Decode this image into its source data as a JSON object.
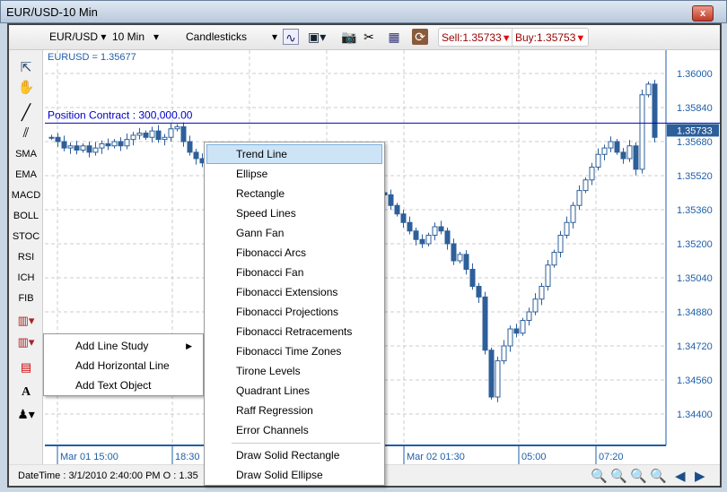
{
  "window": {
    "title": "EUR/USD-10 Min",
    "close": "x"
  },
  "toolbar": {
    "symbol": "EUR/USD",
    "interval": "10 Min",
    "chart_type": "Candlesticks",
    "sell": "Sell:1.35733",
    "buy": "Buy:1.35753",
    "icons": [
      "indicator-chart-icon",
      "save-icon",
      "camera-icon",
      "tools-icon",
      "calculator-icon",
      "refresh-icon"
    ]
  },
  "left_toolbar": {
    "items": [
      "SMA",
      "EMA",
      "MACD",
      "BOLL",
      "STOC",
      "RSI",
      "ICH",
      "FIB"
    ]
  },
  "chart_data": {
    "type": "candlestick",
    "symbol_label": "EURUSD = 1.35677",
    "position_label": "Position  Contract : 300,000.00",
    "position_price": 1.3575,
    "current_price_label": "1.35733",
    "current_price": 1.35733,
    "ylim": [
      1.344,
      1.36
    ],
    "yticks": [
      "1.36000",
      "1.35840",
      "1.35680",
      "1.35520",
      "1.35360",
      "1.35200",
      "1.35040",
      "1.34880",
      "1.34720",
      "1.34560",
      "1.34400"
    ],
    "xticks": [
      "Mar 01 15:00",
      "18:30",
      "Mar 02 01:30",
      "05:00",
      "07:20"
    ],
    "closes": [
      1.357,
      1.3568,
      1.3565,
      1.3566,
      1.3564,
      1.3566,
      1.3563,
      1.3565,
      1.3567,
      1.3566,
      1.3568,
      1.3566,
      1.3569,
      1.3571,
      1.3572,
      1.357,
      1.3573,
      1.3569,
      1.357,
      1.3574,
      1.3575,
      1.3568,
      1.3563,
      1.356,
      1.3558,
      1.3557,
      1.3555,
      1.3556,
      1.3553,
      1.3554,
      1.3552,
      1.355,
      1.3551,
      1.3549,
      1.355,
      1.3548,
      1.3548,
      1.3547,
      1.3549,
      1.3546,
      1.3547,
      1.3544,
      1.3545,
      1.3546,
      1.3544,
      1.3547,
      1.3545,
      1.3546,
      1.3544,
      1.3546,
      1.3543,
      1.3545,
      1.3544,
      1.3543,
      1.3538,
      1.3534,
      1.353,
      1.3526,
      1.3522,
      1.352,
      1.3524,
      1.3528,
      1.3526,
      1.352,
      1.3512,
      1.3515,
      1.3508,
      1.35,
      1.3495,
      1.347,
      1.3448,
      1.3465,
      1.3472,
      1.348,
      1.3478,
      1.3484,
      1.3488,
      1.3494,
      1.35,
      1.351,
      1.3516,
      1.3524,
      1.353,
      1.3538,
      1.3545,
      1.355,
      1.3556,
      1.3562,
      1.3565,
      1.3568,
      1.3563,
      1.356,
      1.3566,
      1.3555,
      1.359,
      1.3595,
      1.357
    ],
    "colors": {
      "candle": "#2d5f9a",
      "axis": "#1f5fa8",
      "position_line": "#0000cc",
      "current_price_bg": "#2d5f9a"
    }
  },
  "context_menu": {
    "items": [
      "Add Line Study",
      "Add Horizontal Line",
      "Add Text Object"
    ]
  },
  "submenu": {
    "items": [
      "Trend Line",
      "Ellipse",
      "Rectangle",
      "Speed Lines",
      "Gann Fan",
      "Fibonacci Arcs",
      "Fibonacci Fan",
      "Fibonacci Extensions",
      "Fibonacci Projections",
      "Fibonacci Retracements",
      "Fibonacci Time Zones",
      "Tirone Levels",
      "Quadrant Lines",
      "Raff Regression",
      "Error Channels"
    ],
    "items2": [
      "Draw Solid Rectangle",
      "Draw Solid Ellipse"
    ],
    "highlighted": "Trend Line"
  },
  "status": {
    "text": "DateTime : 3/1/2010 2:40:00 PM O : 1.35"
  }
}
